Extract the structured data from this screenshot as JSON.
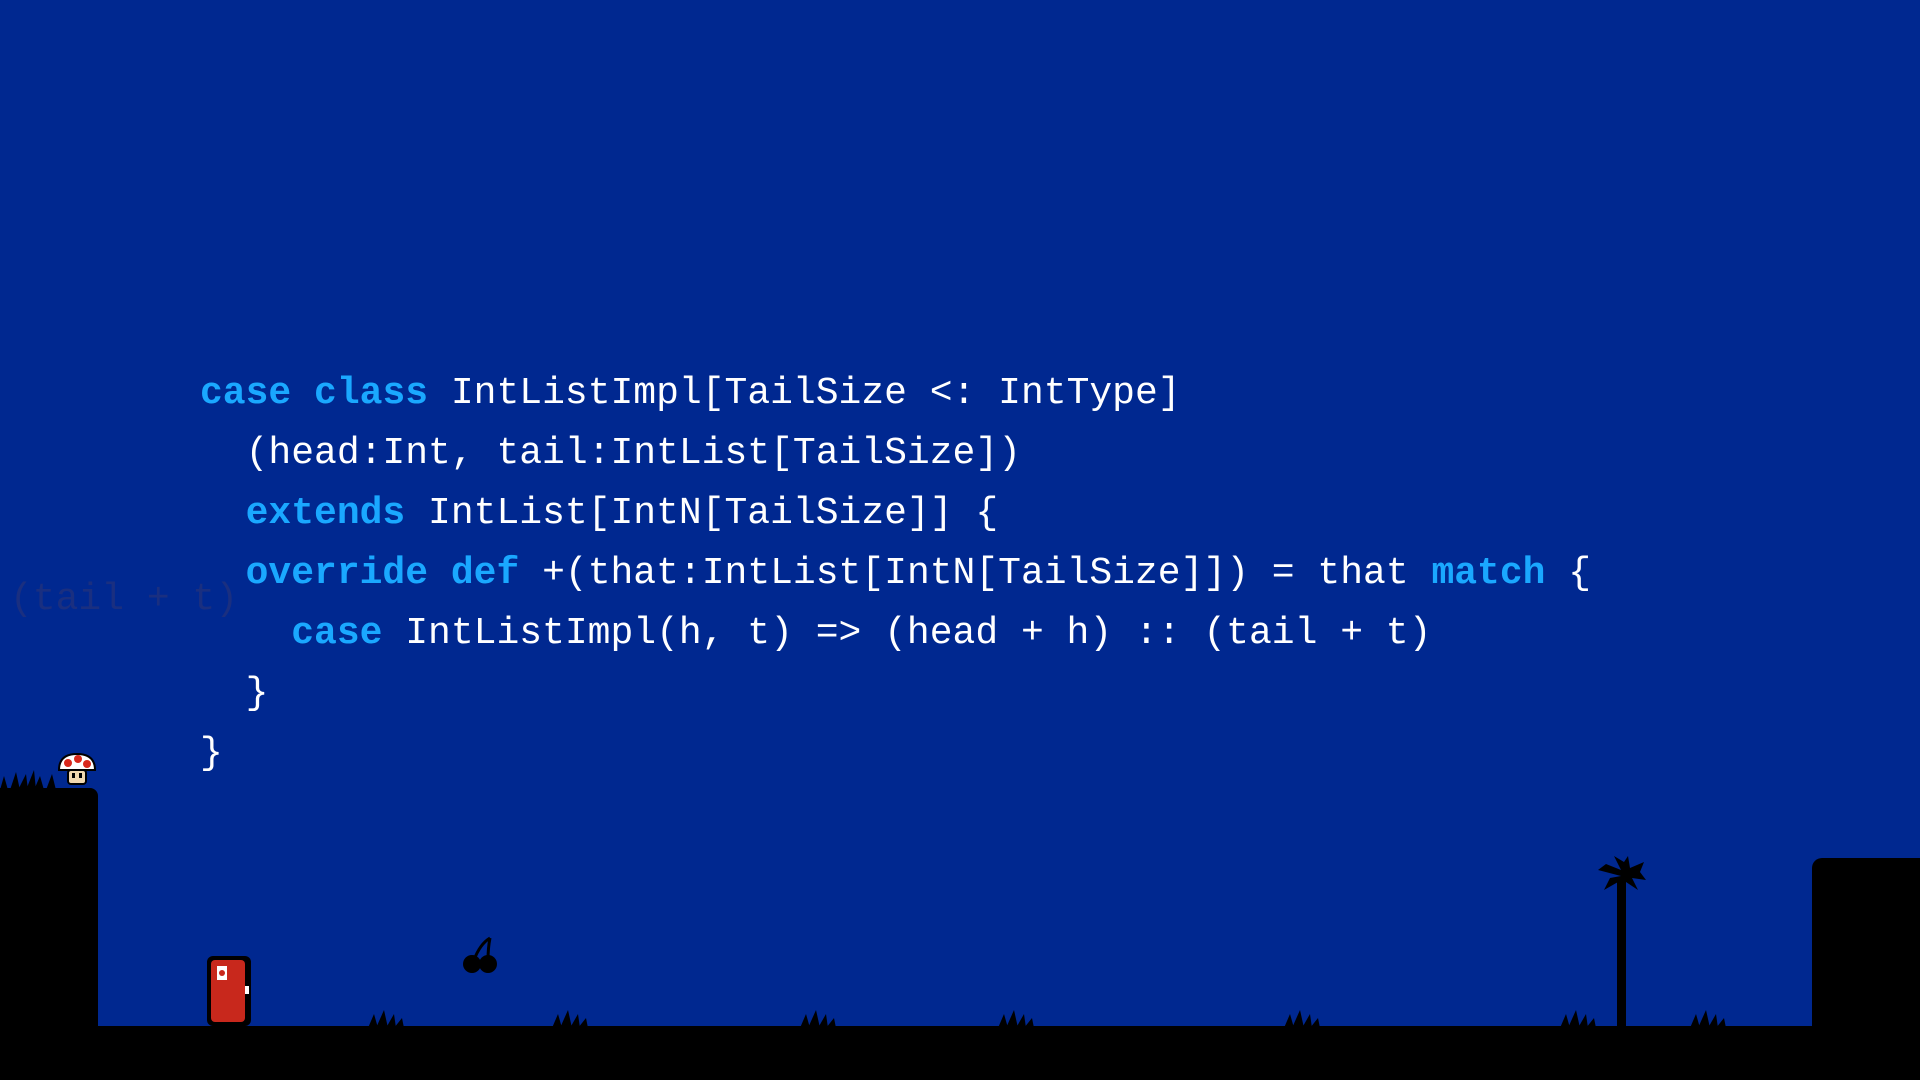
{
  "code": {
    "lines": [
      [
        {
          "t": "case",
          "kw": true
        },
        {
          "t": " "
        },
        {
          "t": "class",
          "kw": true
        },
        {
          "t": " IntListImpl[TailSize <: IntType]"
        }
      ],
      [
        {
          "t": "  (head:Int, tail:IntList[TailSize])"
        }
      ],
      [
        {
          "t": "  "
        },
        {
          "t": "extends",
          "kw": true
        },
        {
          "t": " IntList[IntN[TailSize]] {"
        }
      ],
      [
        {
          "t": "  "
        },
        {
          "t": "override",
          "kw": true
        },
        {
          "t": " "
        },
        {
          "t": "def",
          "kw": true
        },
        {
          "t": " +(that:IntList[IntN[TailSize]]) = that "
        },
        {
          "t": "match",
          "kw": true
        },
        {
          "t": " {"
        }
      ],
      [
        {
          "t": "    "
        },
        {
          "t": "case",
          "kw": true
        },
        {
          "t": " IntListImpl(h, t) => (head + h) :: (tail + t)"
        }
      ],
      [
        {
          "t": "  }"
        }
      ],
      [
        {
          "t": "}"
        }
      ]
    ]
  },
  "ghost_text": "(tail + t)",
  "colors": {
    "background": "#002890",
    "keyword": "#1aa8ff",
    "text": "#ffffff",
    "silhouette": "#000000",
    "door": "#c8281c"
  },
  "sprites": {
    "mushroom": "mushroom-icon",
    "door": "door-icon",
    "cherry": "cherry-icon",
    "palm_tree": "palm-tree-icon",
    "grass": "grass-tuft-icon"
  }
}
